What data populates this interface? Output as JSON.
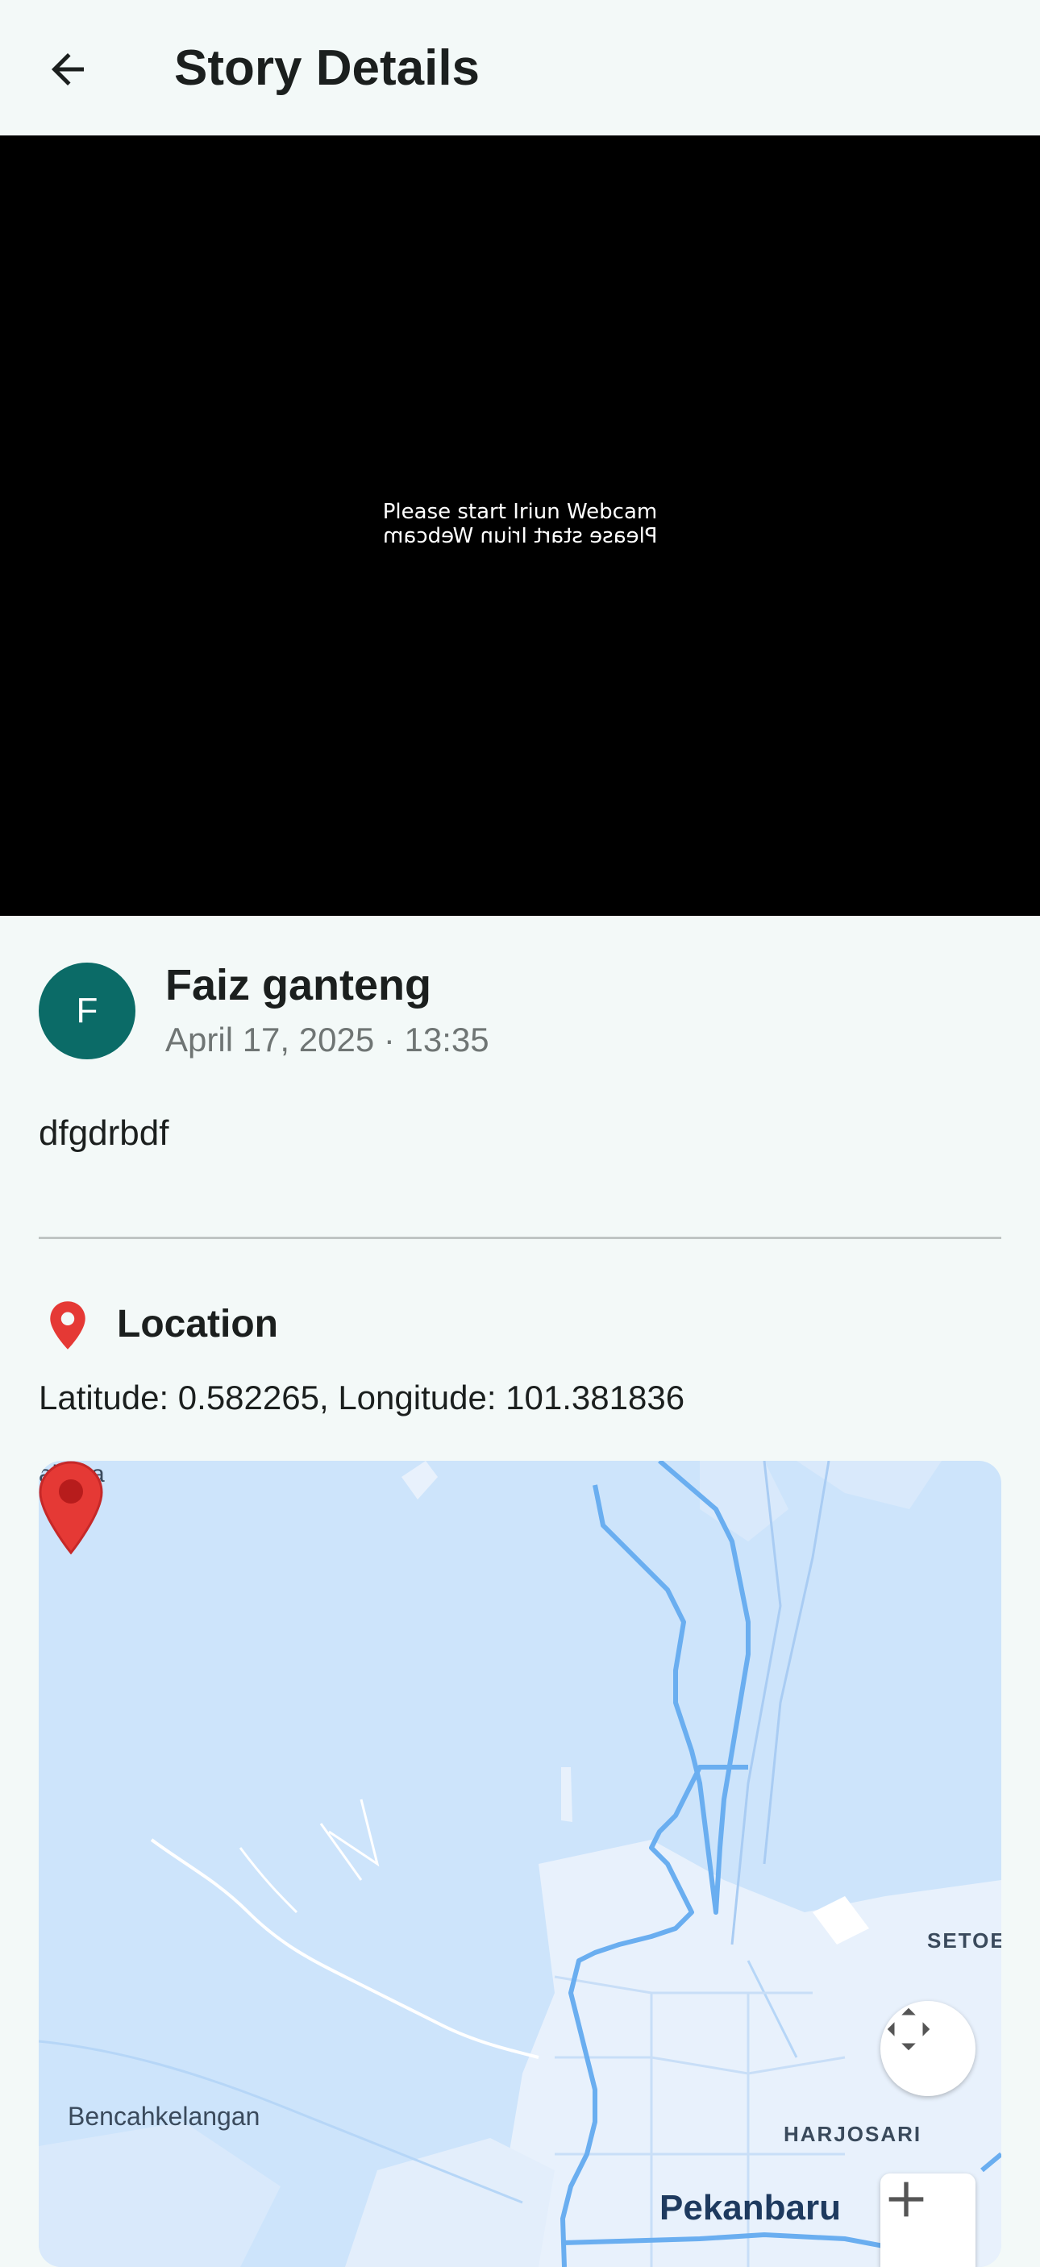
{
  "appbar": {
    "title": "Story Details",
    "back_icon": "arrow-back-icon"
  },
  "media": {
    "line1": "Please start Iriun Webcam",
    "line2": "Please start Iriun Webcam"
  },
  "story": {
    "avatar_letter": "F",
    "author": "Faiz ganteng",
    "date": "April 17, 2025 · 13:35",
    "description": "dfgdrbdf"
  },
  "location": {
    "icon": "location-pin-icon",
    "title": "Location",
    "coords": "Latitude: 0.582265, Longitude: 101.381836"
  },
  "map": {
    "labels": {
      "top_left": "ahtiga",
      "setoe": "SETOE",
      "bencah": "Bencahkelangan",
      "harjosari": "HARJOSARI",
      "pekanbaru": "Pekanbaru"
    },
    "controls": {
      "recenter_icon": "recenter-icon",
      "zoom_in_icon": "zoom-in-icon"
    },
    "marker": "map-marker-icon"
  },
  "colors": {
    "accent": "#0b6b67",
    "marker": "#e53935",
    "water": "#cde4fb",
    "land": "#e8f1fc",
    "road": "#6aaef0"
  }
}
